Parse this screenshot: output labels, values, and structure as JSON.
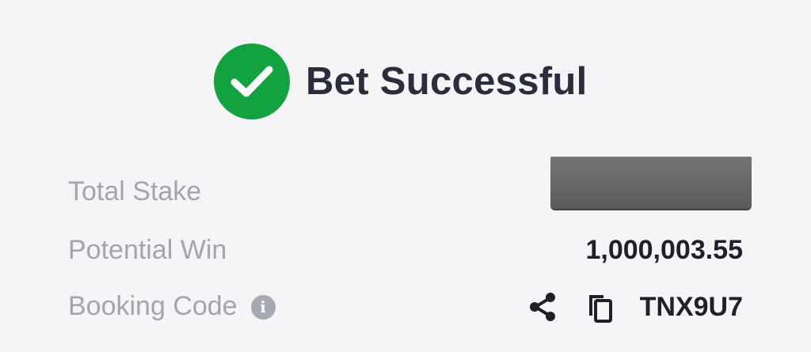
{
  "header": {
    "title": "Bet Successful",
    "status_color": "#12a240",
    "status_icon": "check-circle-icon"
  },
  "summary": {
    "total_stake": {
      "label": "Total Stake",
      "value_redacted": true
    },
    "potential_win": {
      "label": "Potential Win",
      "value": "1,000,003.55"
    },
    "booking_code": {
      "label": "Booking Code",
      "info_icon": "info-icon",
      "info_glyph": "i",
      "share_icon": "share-icon",
      "copy_icon": "copy-icon",
      "value": "TNX9U7"
    }
  }
}
